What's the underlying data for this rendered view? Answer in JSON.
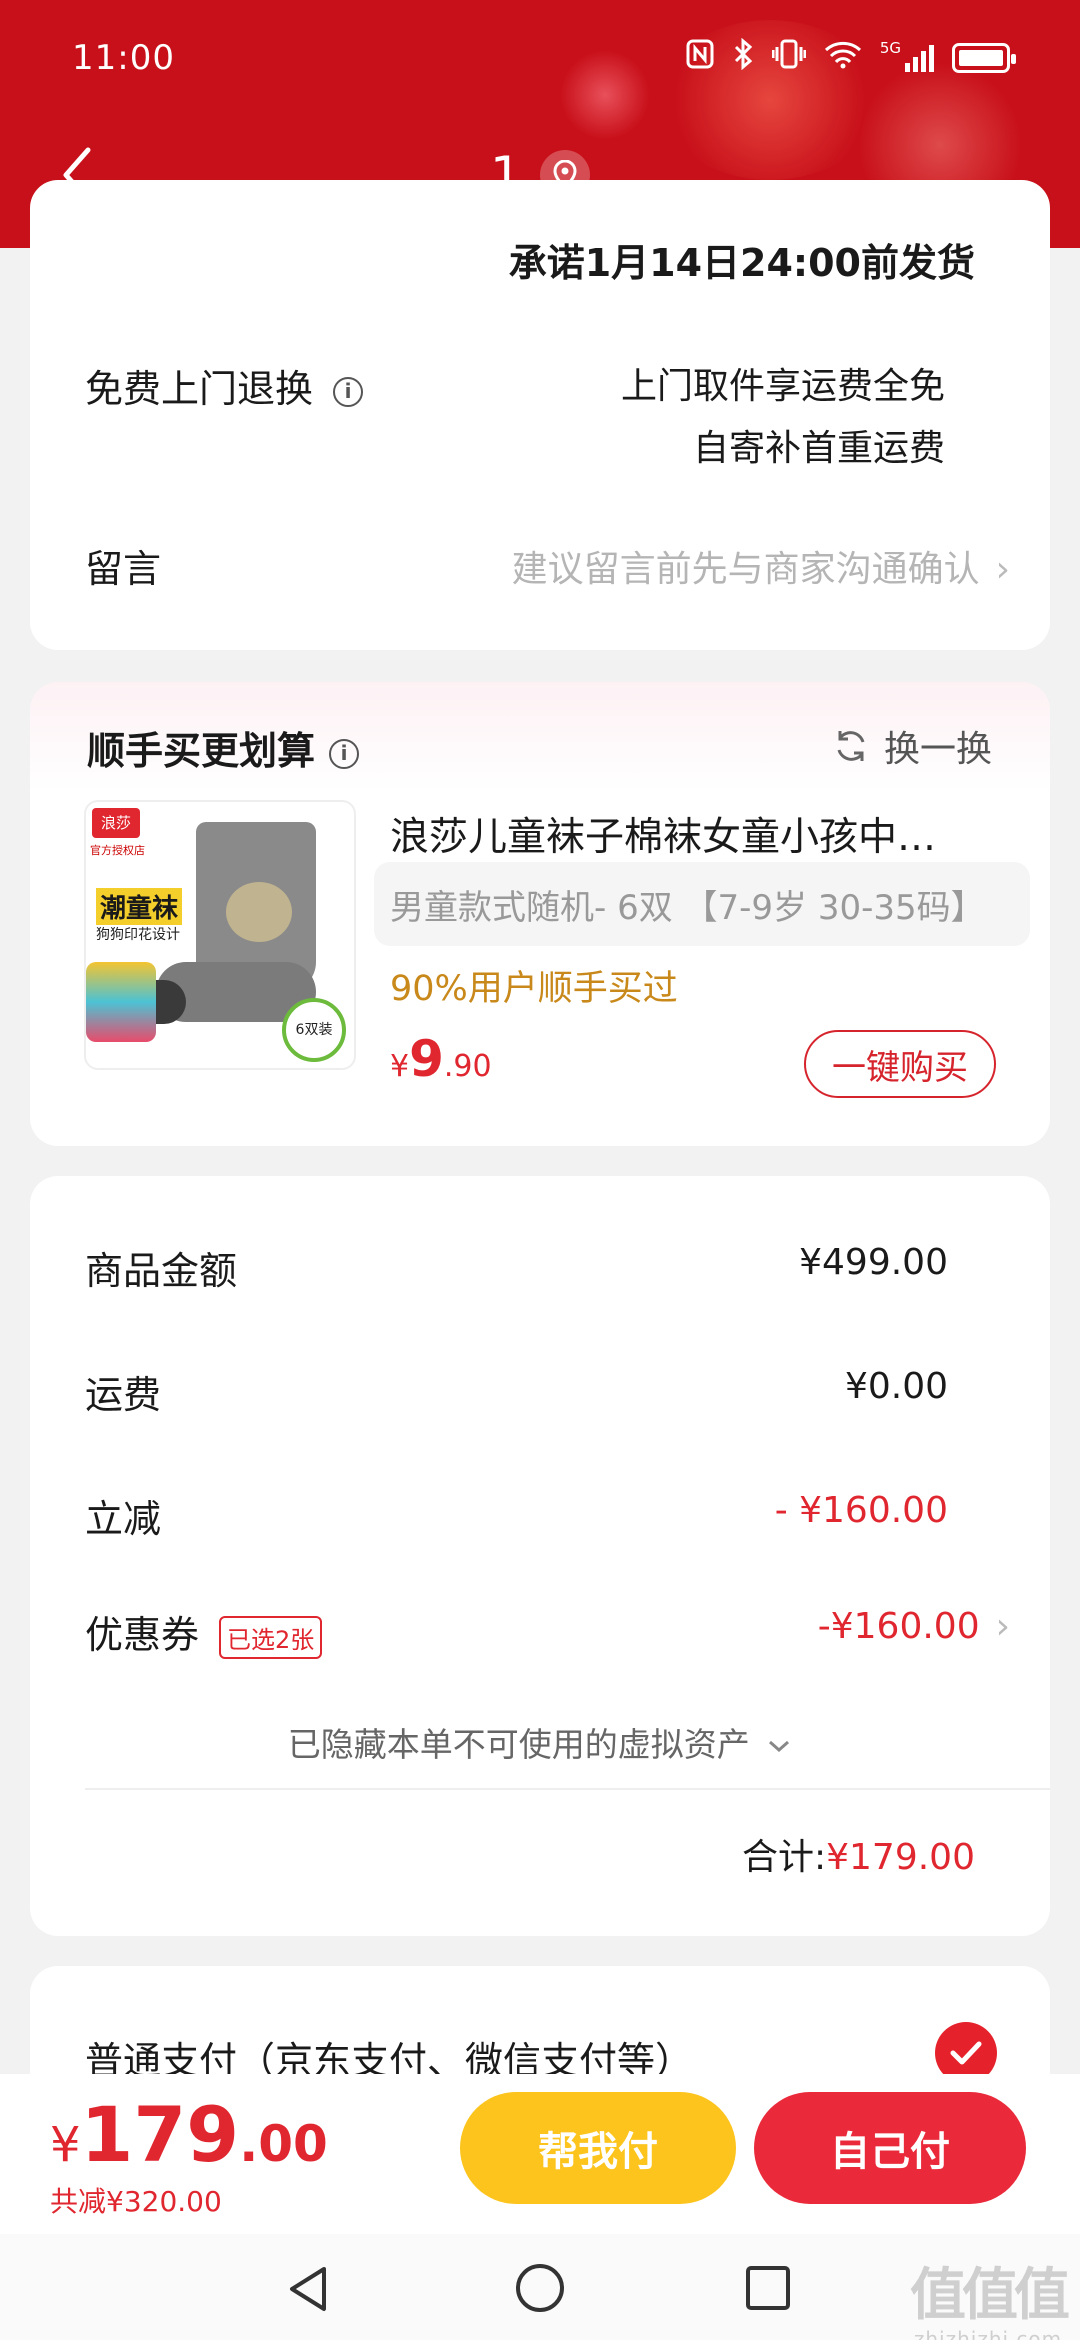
{
  "status_bar": {
    "time": "11:00",
    "network": "5G",
    "icons": [
      "nfc-icon",
      "bluetooth-icon",
      "vibrate-icon",
      "wifi-icon",
      "signal-icon",
      "battery-icon"
    ]
  },
  "nav": {
    "title": "1",
    "back_icon": "chevron-left-icon",
    "location_icon": "location-pin-icon"
  },
  "shipping": {
    "promise": "承诺1月14日24:00前发货",
    "return_label": "免费上门退换",
    "return_line1": "上门取件享运费全免",
    "return_line2": "自寄补首重运费",
    "note_label": "留言",
    "note_placeholder": "建议留言前先与商家沟通确认"
  },
  "upsell": {
    "title": "顺手买更划算",
    "swap_label": "换一换",
    "product_title": "浪莎儿童袜子棉袜女童小孩中筒袜",
    "variant": "男童款式随机- 6双 【7-9岁 30-35码】",
    "sold": "90%用户顺手买过",
    "price_symbol": "¥",
    "price_int": "9",
    "price_dec": ".90",
    "buy_label": "一键购买",
    "image_text": {
      "brand": "浪莎",
      "shop": "官方授权店",
      "tag": "潮童袜",
      "sub": "狗狗印花设计",
      "pack": "6双装"
    }
  },
  "summary": {
    "goods_label": "商品金额",
    "goods_value": "¥499.00",
    "shipping_label": "运费",
    "shipping_value": "¥0.00",
    "discount_label": "立减",
    "discount_value": "- ¥160.00",
    "coupon_label": "优惠券",
    "coupon_tag": "已选2张",
    "coupon_value": "-¥160.00",
    "hidden_note": "已隐藏本单不可使用的虚拟资产",
    "total_label": "合计:",
    "total_value": "¥179.00"
  },
  "payment": {
    "method": "普通支付（京东支付、微信支付等）",
    "selected": true
  },
  "bottom": {
    "price_symbol": "¥",
    "price_int": "179",
    "price_dec": ".00",
    "saved": "共减¥320.00",
    "help_pay": "帮我付",
    "self_pay": "自己付"
  },
  "watermark": {
    "mark": "值值值",
    "text": "zhizhizhi.com"
  },
  "colors": {
    "header": "#c8101a",
    "accent_red": "#e0262f",
    "help_yellow": "#fcc41c",
    "self_red": "#ea2a3a",
    "sold_orange": "#c8881a"
  }
}
